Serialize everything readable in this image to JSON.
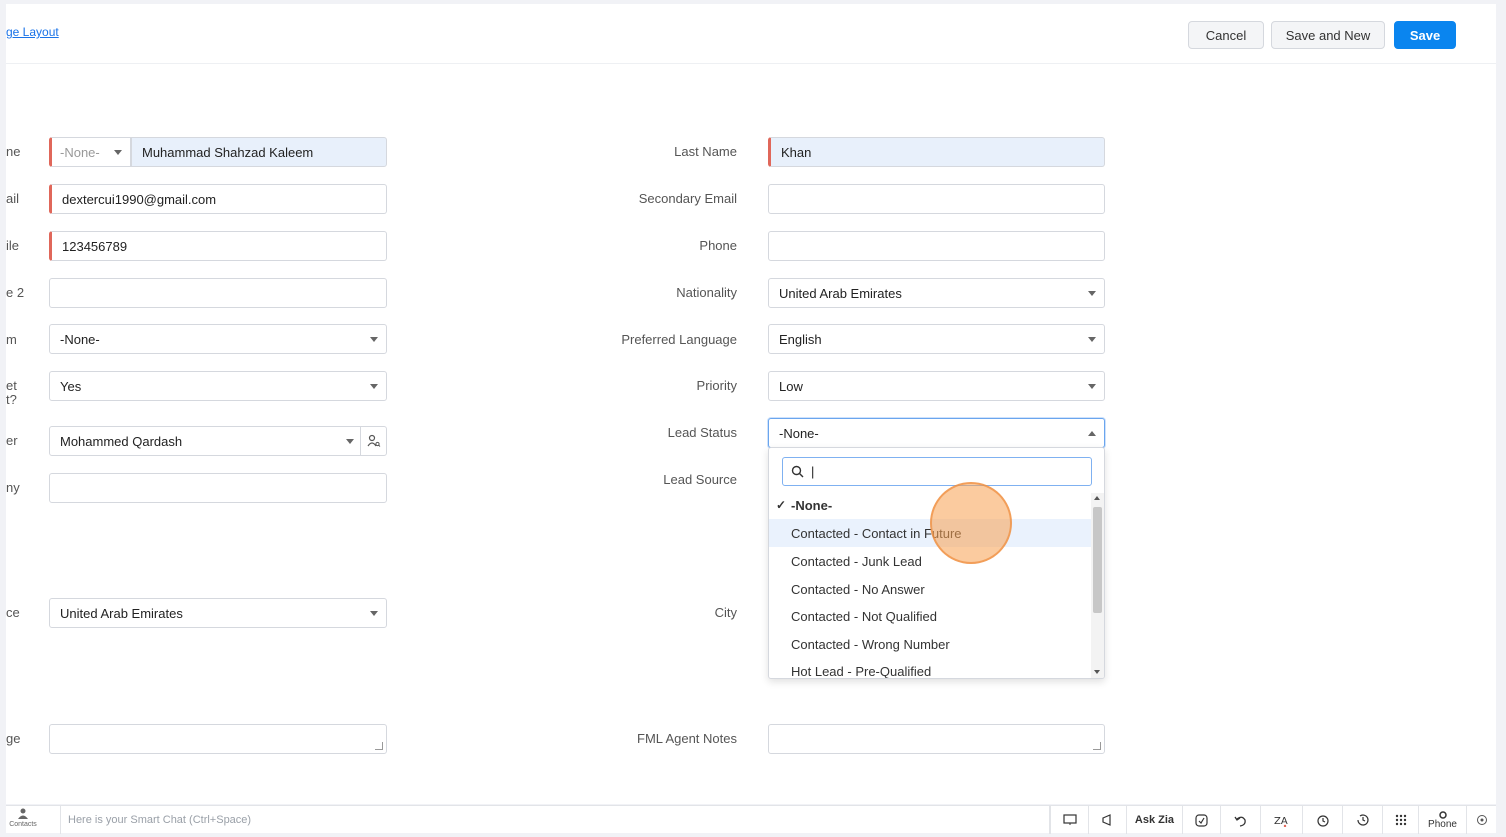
{
  "header": {
    "layout_link": "ge Layout",
    "cancel": "Cancel",
    "save_and_new": "Save and New",
    "save": "Save"
  },
  "left": {
    "labels": [
      "ne",
      "ail",
      "ile",
      "e 2",
      "m",
      "et",
      "t?",
      "er",
      "ny",
      "ce",
      "ge"
    ],
    "salutation": "-None-",
    "first_name": "Muhammad Shahzad Kaleem",
    "email": "dextercui1990@gmail.com",
    "mobile": "123456789",
    "phone2": "",
    "from": "-None-",
    "yes": "Yes",
    "owner": "Mohammed Qardash",
    "company": "",
    "country": "United Arab Emirates",
    "message": ""
  },
  "right": {
    "last_name_label": "Last Name",
    "last_name": "Khan",
    "secondary_email_label": "Secondary Email",
    "secondary_email": "",
    "phone_label": "Phone",
    "phone": "",
    "nationality_label": "Nationality",
    "nationality": "United Arab Emirates",
    "language_label": "Preferred Language",
    "language": "English",
    "priority_label": "Priority",
    "priority": "Low",
    "lead_status_label": "Lead Status",
    "lead_status": "-None-",
    "lead_source_label": "Lead Source",
    "city_label": "City",
    "agent_notes_label": "FML Agent Notes",
    "agent_notes": ""
  },
  "dropdown": {
    "search_value": "|",
    "items": [
      "-None-",
      "Contacted - Contact in Future",
      "Contacted - Junk Lead",
      "Contacted - No Answer",
      "Contacted - Not Qualified",
      "Contacted - Wrong Number",
      "Hot Lead - Pre-Qualified"
    ],
    "selected_index": 0,
    "hover_index": 1
  },
  "bottombar": {
    "contacts": "Contacts",
    "chat_placeholder": "Here is your Smart Chat (Ctrl+Space)",
    "ask_zia": "Ask Zia",
    "phone": "Phone"
  }
}
